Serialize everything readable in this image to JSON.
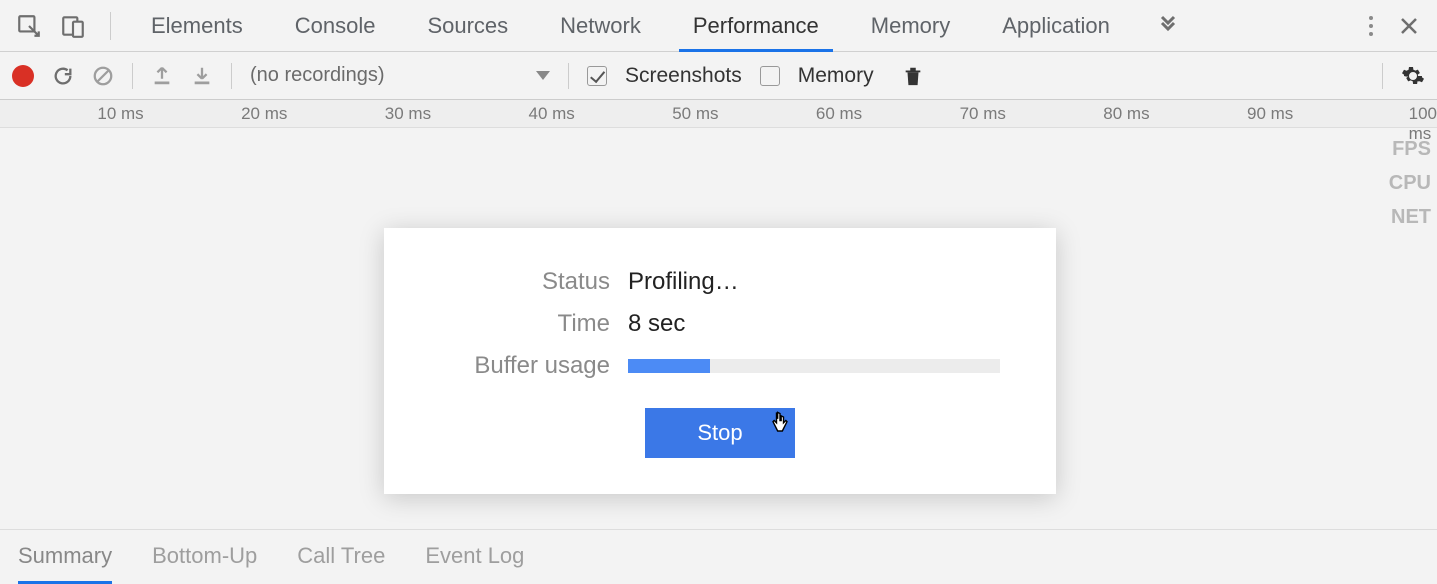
{
  "tabs": {
    "items": [
      "Elements",
      "Console",
      "Sources",
      "Network",
      "Performance",
      "Memory",
      "Application"
    ],
    "active_index": 4
  },
  "toolbar": {
    "recordings_placeholder": "(no recordings)",
    "screenshots_label": "Screenshots",
    "screenshots_checked": true,
    "memory_label": "Memory",
    "memory_checked": false
  },
  "ruler": {
    "ticks": [
      "10 ms",
      "20 ms",
      "30 ms",
      "40 ms",
      "50 ms",
      "60 ms",
      "70 ms",
      "80 ms",
      "90 ms",
      "100 ms"
    ]
  },
  "lanes": [
    "FPS",
    "CPU",
    "NET"
  ],
  "modal": {
    "status_key": "Status",
    "status_value": "Profiling…",
    "time_key": "Time",
    "time_value": "8 sec",
    "buffer_key": "Buffer usage",
    "buffer_percent": 22,
    "stop_label": "Stop"
  },
  "bottom_tabs": {
    "items": [
      "Summary",
      "Bottom-Up",
      "Call Tree",
      "Event Log"
    ],
    "active_index": 0
  }
}
